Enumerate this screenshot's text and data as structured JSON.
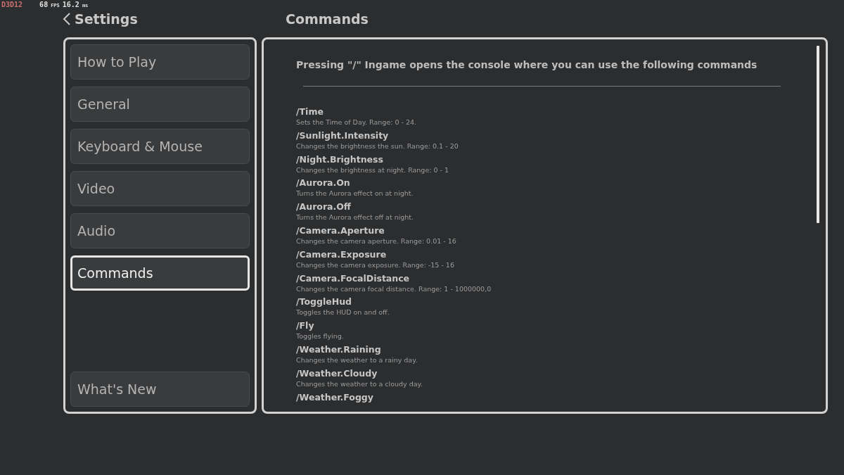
{
  "debug_overlay": {
    "api": "D3D12",
    "fps": "68",
    "fps_unit": "FPS",
    "frame_time": "16.2",
    "frame_time_unit": "ms"
  },
  "header": {
    "back_title": "Settings",
    "section_title": "Commands"
  },
  "sidebar": {
    "items": [
      {
        "label": "How to Play",
        "selected": false
      },
      {
        "label": "General",
        "selected": false
      },
      {
        "label": "Keyboard & Mouse",
        "selected": false
      },
      {
        "label": "Video",
        "selected": false
      },
      {
        "label": "Audio",
        "selected": false
      },
      {
        "label": "Commands",
        "selected": true
      }
    ],
    "bottom_item": {
      "label": "What's New",
      "selected": false
    }
  },
  "content": {
    "intro": "Pressing \"/\" Ingame opens the console where you can use the following commands",
    "commands": [
      {
        "name": "/Time",
        "description": "Sets the Time of Day. Range: 0 - 24."
      },
      {
        "name": "/Sunlight.Intensity",
        "description": "Changes the brightness the sun. Range: 0.1 - 20"
      },
      {
        "name": "/Night.Brightness",
        "description": "Changes the brightness at night. Range: 0 - 1"
      },
      {
        "name": "/Aurora.On",
        "description": "Turns the Aurora effect on at night."
      },
      {
        "name": "/Aurora.Off",
        "description": "Turns the Aurora effect off at night."
      },
      {
        "name": "/Camera.Aperture",
        "description": "Changes the camera aperture. Range: 0.01 - 16"
      },
      {
        "name": "/Camera.Exposure",
        "description": "Changes the camera exposure. Range: -15 - 16"
      },
      {
        "name": "/Camera.FocalDistance",
        "description": "Changes the camera focal distance. Range: 1 - 1000000,0"
      },
      {
        "name": "/ToggleHud",
        "description": "Toggles the HUD on and off."
      },
      {
        "name": "/Fly",
        "description": "Toggles flying."
      },
      {
        "name": "/Weather.Raining",
        "description": "Changes the weather to a rainy day."
      },
      {
        "name": "/Weather.Cloudy",
        "description": "Changes the weather to a cloudy day."
      },
      {
        "name": "/Weather.Foggy"
      }
    ]
  }
}
